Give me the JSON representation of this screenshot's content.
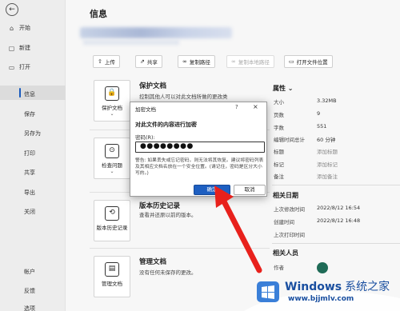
{
  "sidebar": {
    "items": [
      {
        "icon": "home-icon",
        "label": "开始"
      },
      {
        "icon": "new-doc-icon",
        "label": "新建"
      },
      {
        "icon": "folder-icon",
        "label": "打开"
      },
      {
        "label": "信息"
      },
      {
        "label": "保存"
      },
      {
        "label": "另存为"
      },
      {
        "label": "打印"
      },
      {
        "label": "共享"
      },
      {
        "label": "导出"
      },
      {
        "label": "关闭"
      },
      {
        "label": "帐户"
      },
      {
        "label": "反馈"
      },
      {
        "label": "选项"
      }
    ]
  },
  "main": {
    "title": "信息",
    "toolbar": [
      "上传",
      "共享",
      "复制路径",
      "复制本地路径",
      "打开文件位置"
    ],
    "sections": [
      {
        "card_label": "保护文档",
        "title": "保护文档",
        "desc": "控制其他人可以对此文档所做的更改类"
      },
      {
        "card_label": "检查问题",
        "title": "",
        "desc": ""
      },
      {
        "card_label": "版本历史记录",
        "title": "版本历史记录",
        "desc": "查看并还原以前的版本。"
      },
      {
        "card_label": "管理文档",
        "title": "管理文档",
        "desc": "没有任何未保存的更改。"
      }
    ]
  },
  "properties": {
    "header": "属性",
    "rows": [
      {
        "label": "大小",
        "value": "3.32MB"
      },
      {
        "label": "页数",
        "value": "9"
      },
      {
        "label": "字数",
        "value": "551"
      },
      {
        "label": "编辑时间总计",
        "value": "60 分钟"
      },
      {
        "label": "标题",
        "value": "添加标题"
      },
      {
        "label": "标记",
        "value": "添加标记"
      },
      {
        "label": "备注",
        "value": "添加备注"
      }
    ],
    "dates_header": "相关日期",
    "dates": [
      {
        "label": "上次修改时间",
        "value": "2022/8/12 16:54"
      },
      {
        "label": "创建时间",
        "value": "2022/8/12 16:48"
      },
      {
        "label": "上次打印时间",
        "value": ""
      }
    ],
    "people_header": "相关人员",
    "people_author": "作者"
  },
  "dialog": {
    "title": "加密文档",
    "section": "对此文件的内容进行加密",
    "password_label": "密码(R):",
    "password_value": "●●●●●●●●",
    "warning": "警告: 如果丢失或忘记密码，则无法将其恢复。建议将密码列表及其相应文档名放在一个安全位置。(请记住，密码是区分大小写的。)",
    "ok": "确定",
    "cancel": "取消",
    "help": "?",
    "close": "×"
  },
  "watermark": {
    "brand": "Windows",
    "brand_suffix": "系统之家",
    "url": "www.bjjmlv.com",
    "colors": {
      "accent": "#1a4fa0"
    }
  }
}
